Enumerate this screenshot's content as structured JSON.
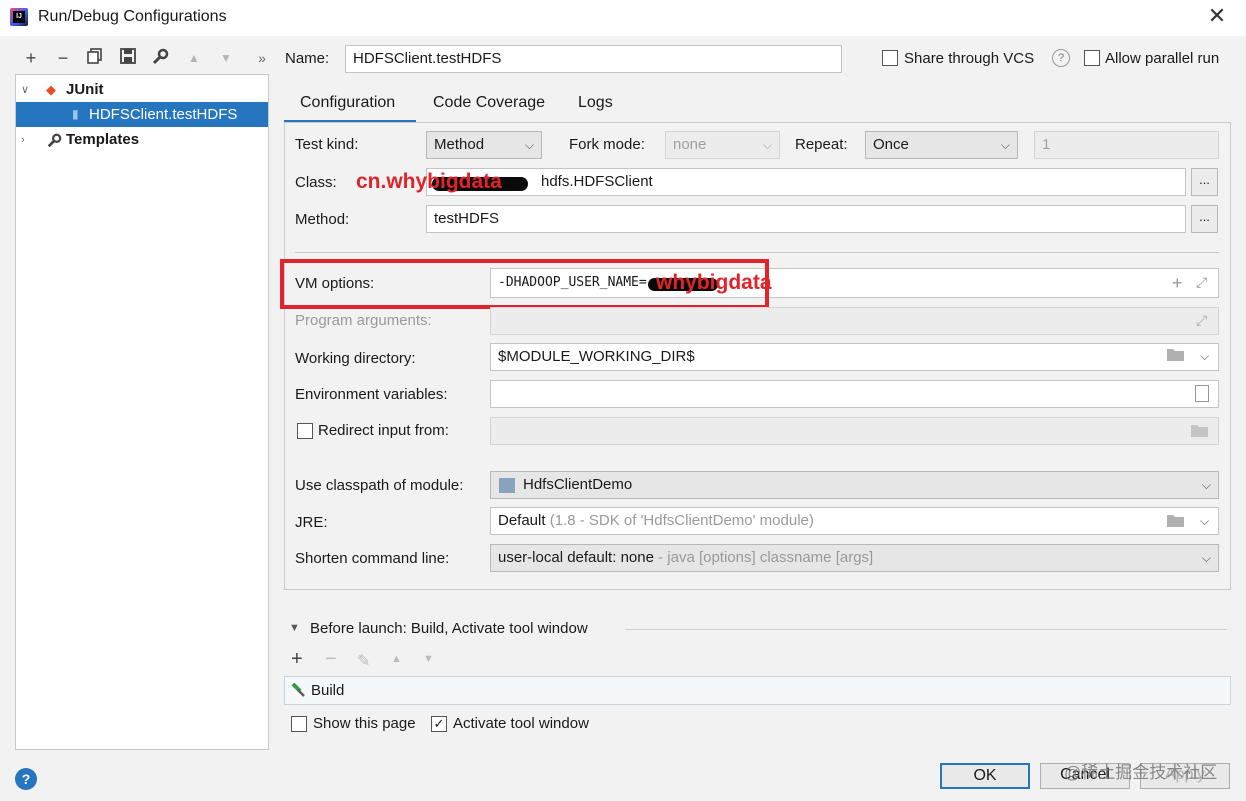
{
  "window": {
    "title": "Run/Debug Configurations",
    "close": "✕"
  },
  "toolbar": {
    "add": "+",
    "remove": "−",
    "copy": "⧉",
    "save": "💾",
    "edit": "🔧",
    "up": "▲",
    "down": "▼",
    "more": "»"
  },
  "tree": {
    "root": "JUnit",
    "child": "HDFSClient.testHDFS",
    "templates": "Templates"
  },
  "name": {
    "label": "Name:",
    "value": "HDFSClient.testHDFS"
  },
  "share_vcs": {
    "label": "Share through VCS",
    "help": "?"
  },
  "allow_parallel": {
    "label": "Allow parallel run"
  },
  "tabs": [
    "Configuration",
    "Code Coverage",
    "Logs"
  ],
  "config": {
    "test_kind_label": "Test kind:",
    "test_kind_value": "Method",
    "fork_label": "Fork mode:",
    "fork_value": "none",
    "repeat_label": "Repeat:",
    "repeat_value": "Once",
    "repeat_count": "1",
    "class_label": "Class:",
    "class_value": "hdfs.HDFSClient",
    "method_label": "Method:",
    "method_value": "testHDFS",
    "vm_label": "VM options:",
    "vm_value": "-DHADOOP_USER_NAME=",
    "prog_label": "Program arguments:",
    "wd_label": "Working directory:",
    "wd_value": "$MODULE_WORKING_DIR$",
    "env_label": "Environment variables:",
    "redirect_label": "Redirect input from:",
    "module_label": "Use classpath of module:",
    "module_value": "HdfsClientDemo",
    "jre_label": "JRE:",
    "jre_value": "Default",
    "jre_hint": "(1.8 - SDK of 'HdfsClientDemo' module)",
    "shorten_label": "Shorten command line:",
    "shorten_value": "user-local default: none",
    "shorten_hint": " - java [options] classname [args]",
    "dots": "..."
  },
  "annotations": {
    "class_overlay": "cn.whybigdata",
    "vm_overlay": "whybigdata"
  },
  "before_launch": {
    "title": "Before launch: Build, Activate tool window",
    "item": "Build",
    "show_page": "Show this page",
    "activate": "Activate tool window"
  },
  "buttons": {
    "ok": "OK",
    "cancel": "Cancel",
    "apply": "Apply",
    "help": "?"
  },
  "watermark": "@稀土掘金技术社区"
}
